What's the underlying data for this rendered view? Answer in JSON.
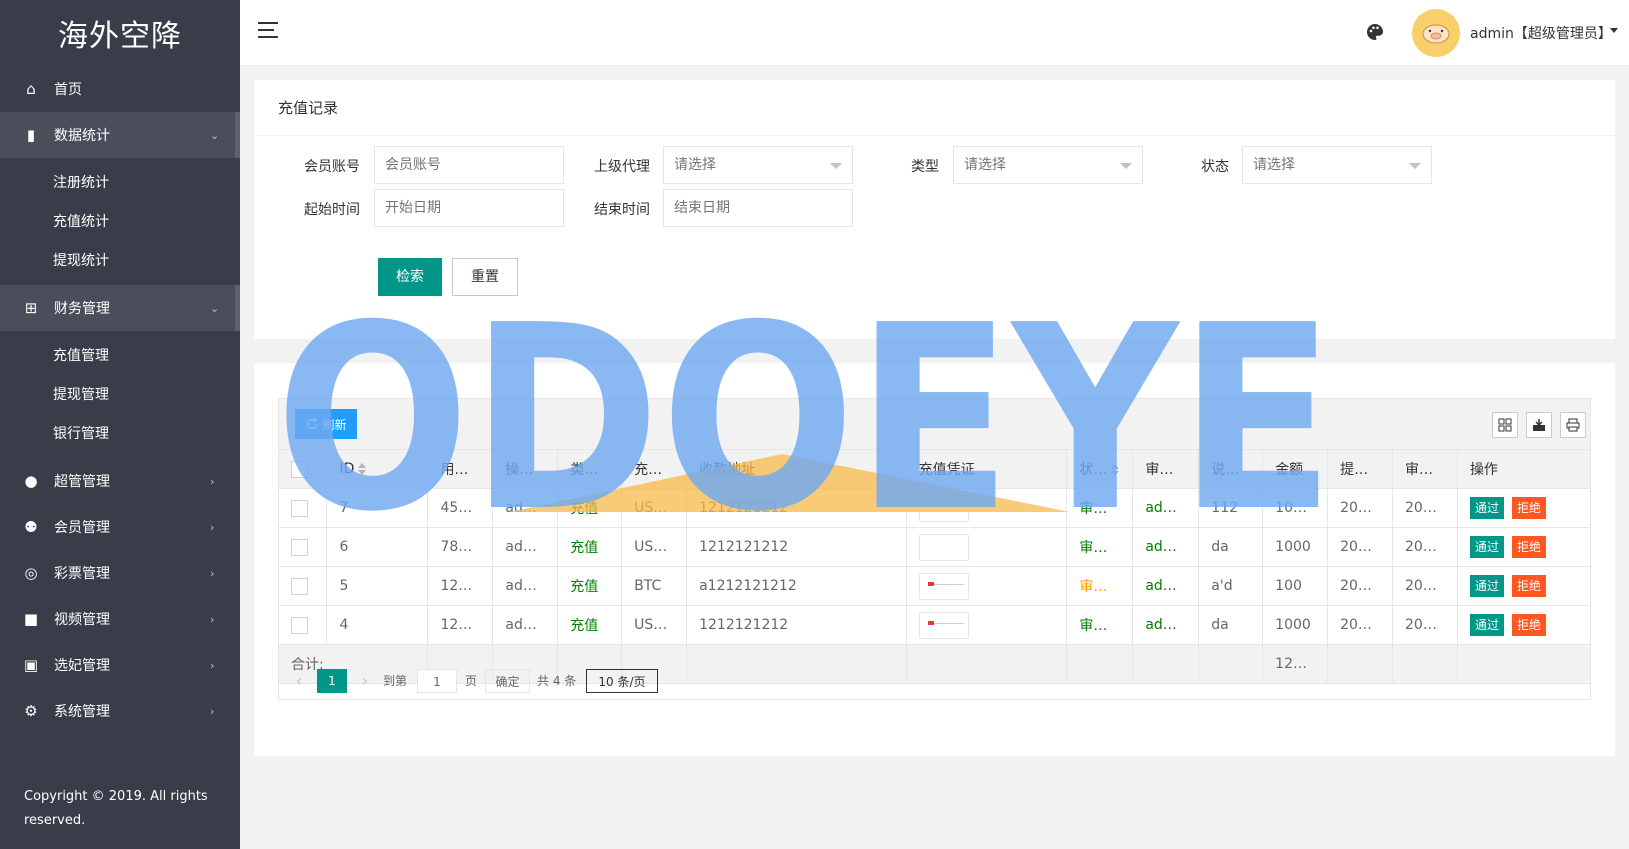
{
  "app": {
    "title": "海外空降"
  },
  "sidebar": {
    "items": [
      {
        "label": "首页",
        "icon": "home-icon"
      },
      {
        "label": "数据统计",
        "icon": "bar-chart-icon",
        "open": true,
        "children": [
          "注册统计",
          "充值统计",
          "提现统计"
        ]
      },
      {
        "label": "财务管理",
        "icon": "bank-icon",
        "open": true,
        "children": [
          "充值管理",
          "提现管理",
          "银行管理"
        ]
      },
      {
        "label": "超管管理",
        "icon": "user-icon"
      },
      {
        "label": "会员管理",
        "icon": "users-icon"
      },
      {
        "label": "彩票管理",
        "icon": "gamepad-icon"
      },
      {
        "label": "视频管理",
        "icon": "video-icon"
      },
      {
        "label": "选妃管理",
        "icon": "camera-icon"
      },
      {
        "label": "系统管理",
        "icon": "gear-icon"
      }
    ],
    "copyright": "Copyright © 2019. All rights reserved."
  },
  "header": {
    "user": "admin【超级管理员】"
  },
  "filter": {
    "title": "充值记录",
    "member_label": "会员账号",
    "member_placeholder": "会员账号",
    "agent_label": "上级代理",
    "agent_value": "请选择",
    "type_label": "类型",
    "type_value": "请选择",
    "status_label": "状态",
    "status_value": "请选择",
    "start_label": "起始时间",
    "start_placeholder": "开始日期",
    "end_label": "结束时间",
    "end_placeholder": "结束日期",
    "search_btn": "检索",
    "reset_btn": "重置"
  },
  "table": {
    "refresh_label": "刷新",
    "columns": [
      "ID",
      "用…",
      "操…",
      "类…",
      "充…",
      "收款地址",
      "充值凭证",
      "状…",
      "审…",
      "说…",
      "金额",
      "提…",
      "审…",
      "操作"
    ],
    "rows": [
      {
        "id": "7",
        "user": "45…",
        "op": "ad…",
        "type": "充值",
        "currency": "US…",
        "address": "1212121212",
        "status": "审核通过",
        "auditor": "admin",
        "note": "112",
        "amount": "10…",
        "submit": "20…",
        "audit_time": "20…",
        "voucher": "blank"
      },
      {
        "id": "6",
        "user": "78…",
        "op": "ad…",
        "type": "充值",
        "currency": "US…",
        "address": "1212121212",
        "status": "审核通过",
        "auditor": "admin",
        "note": "da",
        "amount": "1000",
        "submit": "20…",
        "audit_time": "20…",
        "voucher": "blank"
      },
      {
        "id": "5",
        "user": "12…",
        "op": "ad…",
        "type": "充值",
        "currency": "BTC",
        "address": "a1212121212",
        "status": "审核拒绝",
        "auditor": "admin",
        "note": "a'd",
        "amount": "100",
        "submit": "20…",
        "audit_time": "20…",
        "voucher": "image"
      },
      {
        "id": "4",
        "user": "12…",
        "op": "ad…",
        "type": "充值",
        "currency": "US…",
        "address": "1212121212",
        "status": "审核通过",
        "auditor": "admin",
        "note": "da",
        "amount": "1000",
        "submit": "20…",
        "audit_time": "20…",
        "voucher": "image"
      }
    ],
    "pass_label": "通过",
    "reject_label": "拒绝",
    "total_label": "合计:",
    "total_amount": "12…"
  },
  "pagination": {
    "current": "1",
    "goto_label": "到第",
    "goto_value": "1",
    "page_unit": "页",
    "confirm": "确定",
    "total": "共 4 条",
    "page_size": "10 条/页"
  },
  "watermark": "ODOEYE",
  "colors": {
    "sidebar": "#393d49",
    "primary": "#009688",
    "refresh": "#1e9fff",
    "reject": "#ff5722",
    "watermark": "#6fa8f0"
  }
}
